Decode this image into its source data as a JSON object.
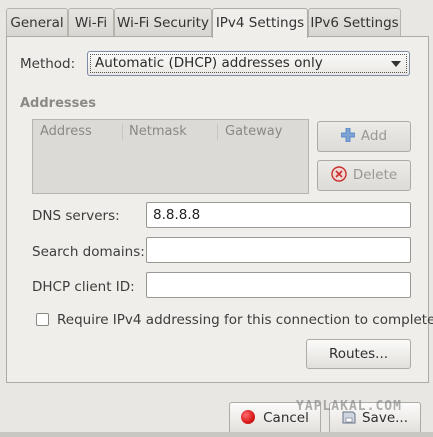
{
  "tabs": [
    {
      "label": "General"
    },
    {
      "label": "Wi-Fi"
    },
    {
      "label": "Wi-Fi Security"
    },
    {
      "label": "IPv4 Settings"
    },
    {
      "label": "IPv6 Settings"
    }
  ],
  "active_tab": "IPv4 Settings",
  "method": {
    "label": "Method:",
    "value": "Automatic (DHCP) addresses only"
  },
  "addresses": {
    "section_title": "Addresses",
    "columns": [
      "Address",
      "Netmask",
      "Gateway"
    ],
    "add_label": "Add",
    "delete_label": "Delete"
  },
  "dns": {
    "label": "DNS servers:",
    "value": "8.8.8.8"
  },
  "search_domains": {
    "label": "Search domains:",
    "value": ""
  },
  "dhcp_client_id": {
    "label": "DHCP client ID:",
    "value": ""
  },
  "require_ipv4": {
    "label": "Require IPv4 addressing for this connection to complete",
    "checked": false
  },
  "routes_label": "Routes...",
  "cancel_label": "Cancel",
  "save_label": "Save...",
  "watermark": "YAPLAKAL.COM",
  "colors": {
    "cancel_icon": "#d9191a",
    "add_icon": "#4a7fc1",
    "delete_icon": "#c8302c"
  }
}
